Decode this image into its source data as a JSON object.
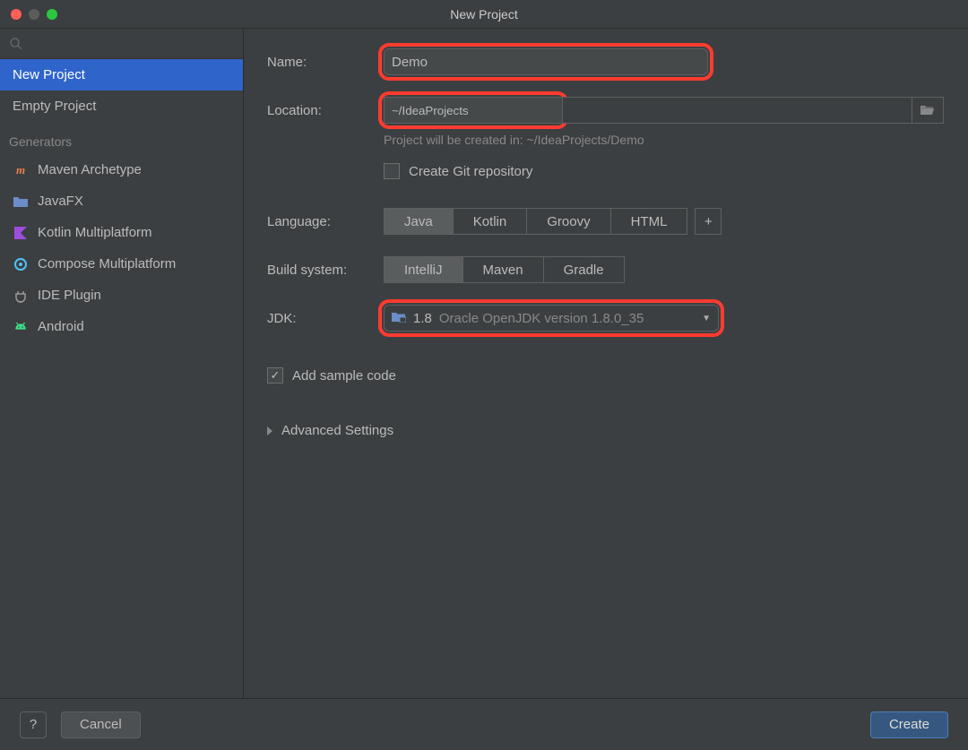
{
  "window": {
    "title": "New Project"
  },
  "sidebar": {
    "main_items": [
      {
        "label": "New Project"
      },
      {
        "label": "Empty Project"
      }
    ],
    "section_label": "Generators",
    "generators": [
      {
        "label": "Maven Archetype"
      },
      {
        "label": "JavaFX"
      },
      {
        "label": "Kotlin Multiplatform"
      },
      {
        "label": "Compose Multiplatform"
      },
      {
        "label": "IDE Plugin"
      },
      {
        "label": "Android"
      }
    ]
  },
  "form": {
    "name_label": "Name:",
    "name_value": "Demo",
    "location_label": "Location:",
    "location_value": "~/IdeaProjects",
    "location_hint": "Project will be created in: ~/IdeaProjects/Demo",
    "git_label": "Create Git repository",
    "language_label": "Language:",
    "languages": [
      "Java",
      "Kotlin",
      "Groovy",
      "HTML"
    ],
    "build_label": "Build system:",
    "build_systems": [
      "IntelliJ",
      "Maven",
      "Gradle"
    ],
    "jdk_label": "JDK:",
    "jdk_short": "1.8",
    "jdk_desc": "Oracle OpenJDK version 1.8.0_35",
    "sample_label": "Add sample code",
    "advanced_label": "Advanced Settings",
    "plus": "+"
  },
  "footer": {
    "help": "?",
    "cancel": "Cancel",
    "create": "Create"
  }
}
